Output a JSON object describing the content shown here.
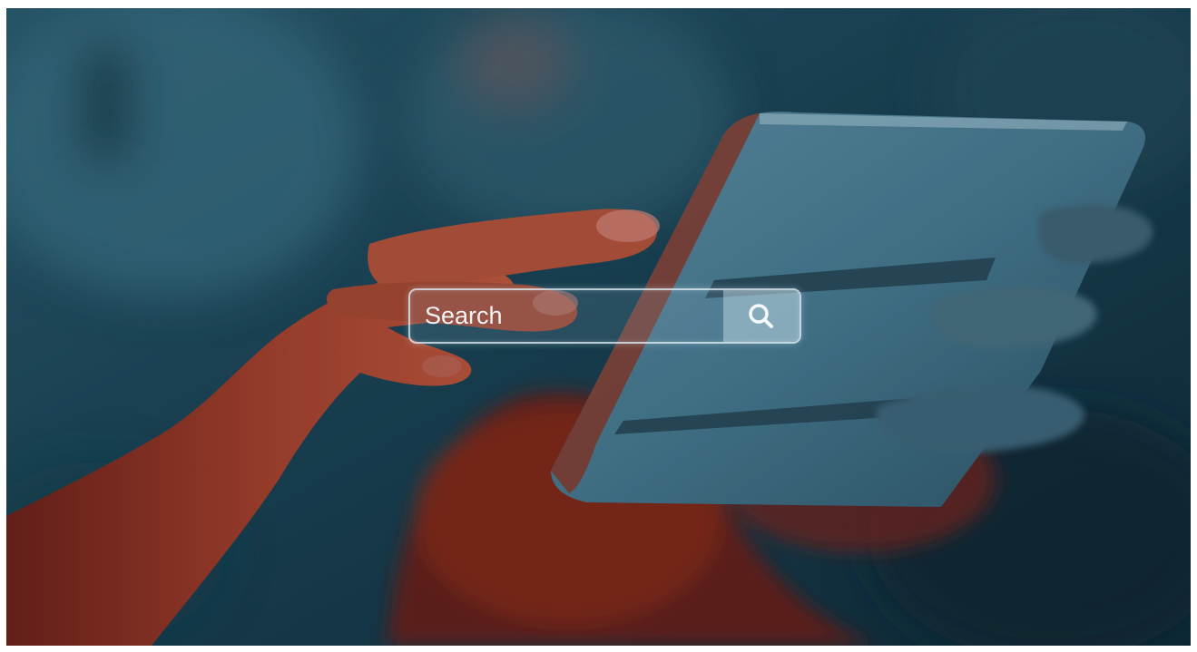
{
  "search": {
    "placeholder": "Search",
    "button_icon": "search-icon"
  },
  "colors": {
    "background": "#16394a",
    "frame_border": "#e1f0f8",
    "hand_tone": "#b0402c"
  }
}
